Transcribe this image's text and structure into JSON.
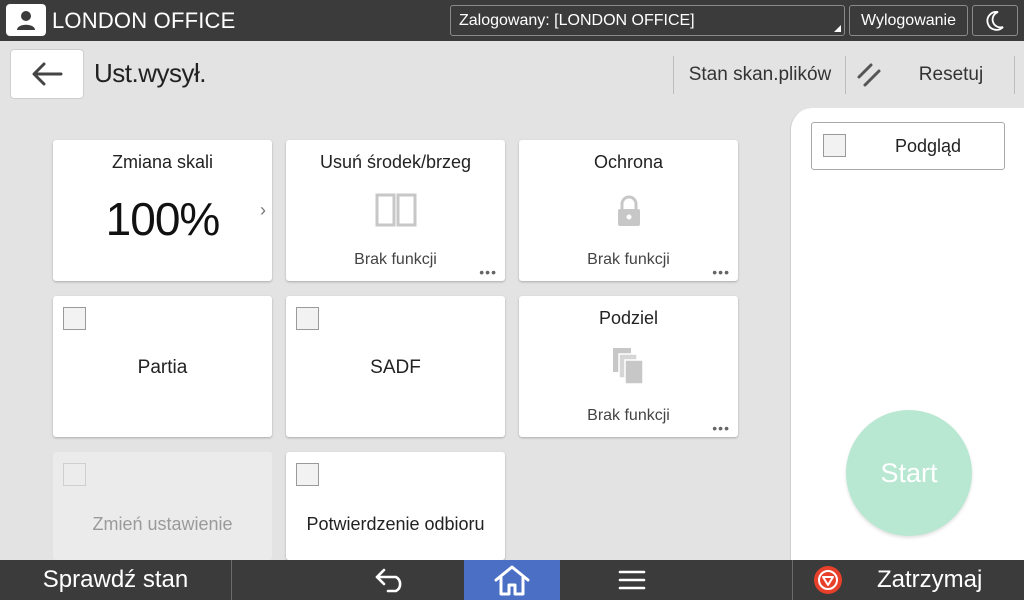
{
  "topbar": {
    "office_name": "LONDON OFFICE",
    "login_select": "Zalogowany: [LONDON OFFICE]",
    "logout_label": "Wylogowanie",
    "user_icon": "user-icon",
    "sleep_icon": "moon-icon"
  },
  "header": {
    "title": "Ust.wysył.",
    "scan_status_label": "Stan skan.plików",
    "reset_label": "Resetuj"
  },
  "tiles": {
    "scale": {
      "title": "Zmiana skali",
      "value": "100%",
      "chevron": "›"
    },
    "erase": {
      "title": "Usuń środek/brzeg",
      "sub": "Brak funkcji",
      "dots": "•••"
    },
    "protect": {
      "title": "Ochrona",
      "sub": "Brak funkcji",
      "dots": "•••"
    },
    "batch": {
      "label": "Partia",
      "checked": false
    },
    "sadf": {
      "label": "SADF",
      "checked": false
    },
    "split": {
      "title": "Podziel",
      "sub": "Brak funkcji",
      "dots": "•••"
    },
    "change_settings": {
      "label": "Zmień ustawienie",
      "checked": false,
      "disabled": true
    },
    "receipt": {
      "label": "Potwierdzenie odbioru",
      "checked": false
    }
  },
  "right_panel": {
    "preview_label": "Podgląd",
    "preview_checked": false,
    "start_label": "Start",
    "start_color": "#b8e8d2"
  },
  "bottombar": {
    "check_status_label": "Sprawdź stan",
    "stop_label": "Zatrzymaj",
    "home_color": "#4a6fc4",
    "stop_color": "#e8402a"
  }
}
